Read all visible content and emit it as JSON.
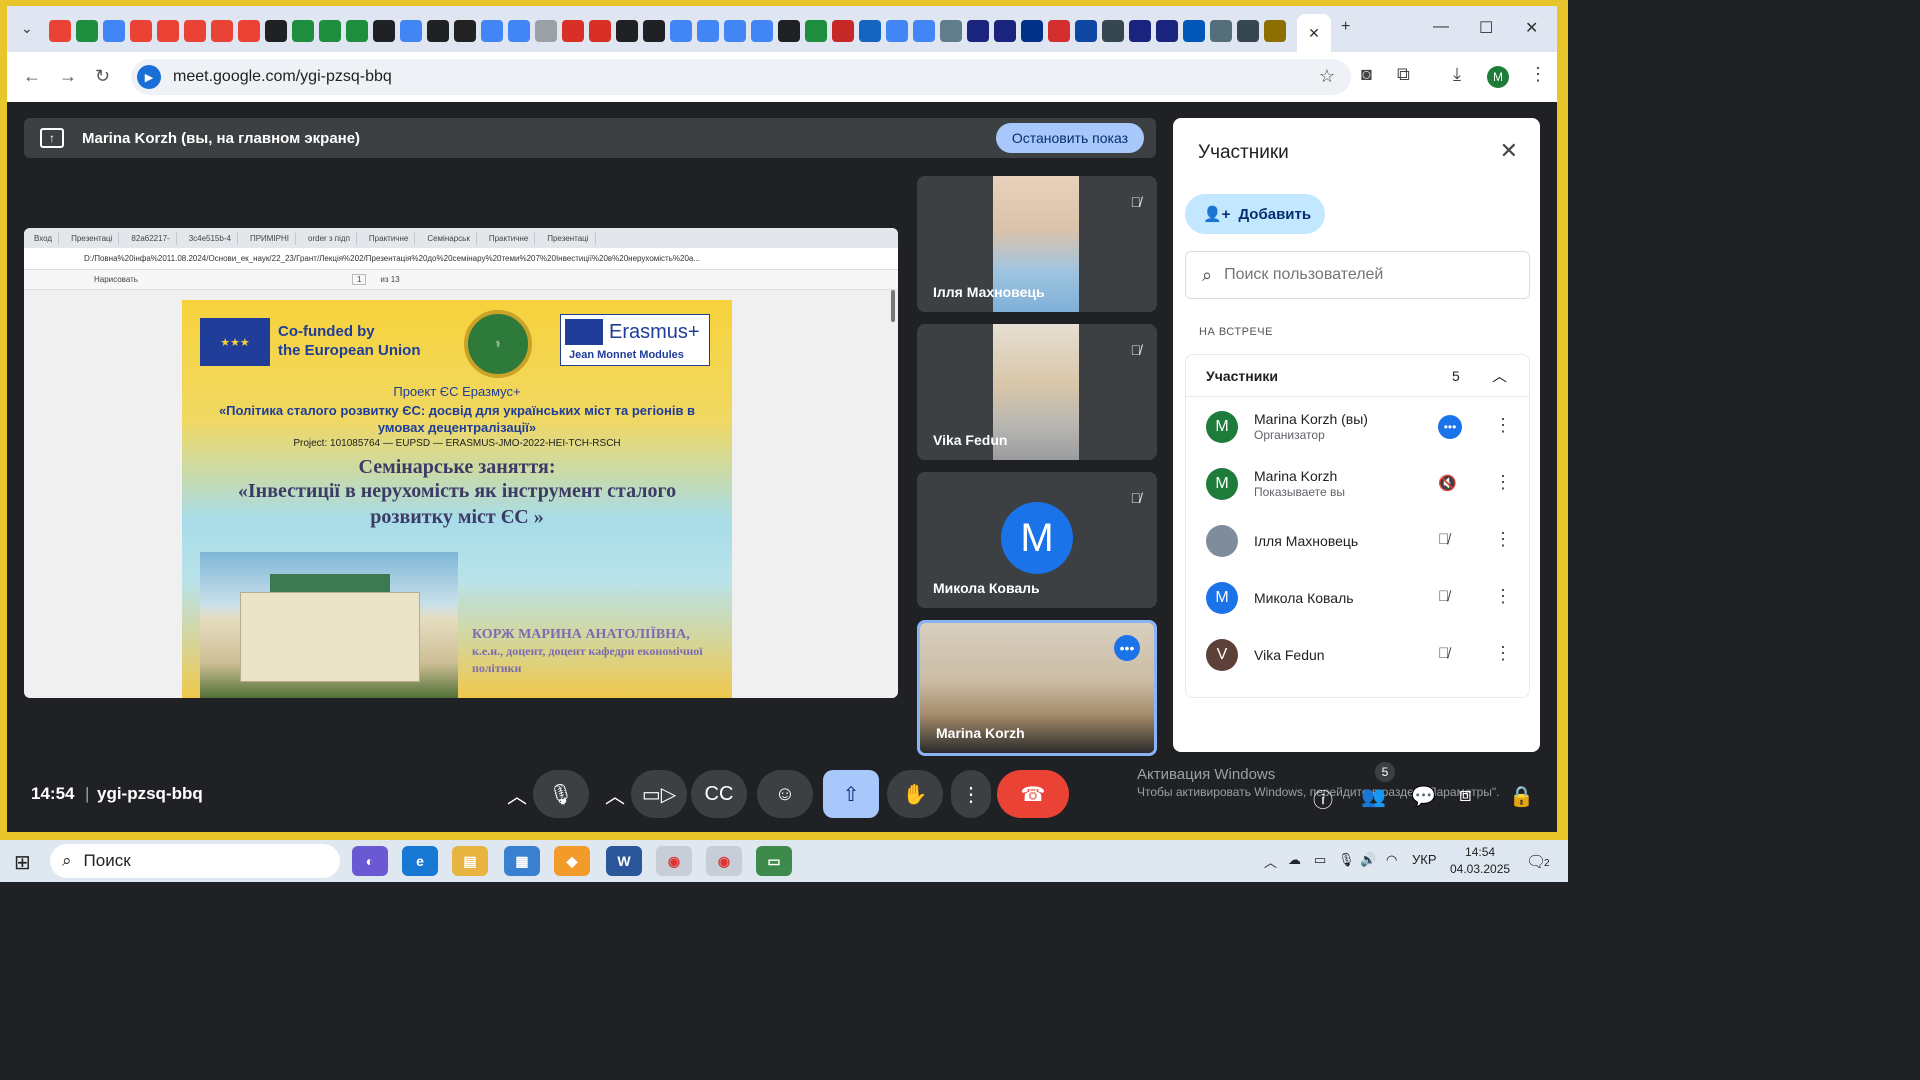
{
  "browser": {
    "url": "meet.google.com/ygi-pzsq-bbq",
    "tab_favicons": [
      "gmail",
      "drive",
      "docs",
      "gmail",
      "gmail",
      "gmail",
      "gmail",
      "gmail",
      "book",
      "drive",
      "drive",
      "drive",
      "book",
      "docs",
      "book",
      "openai",
      "docs",
      "google",
      "help",
      "heart",
      "heart",
      "book",
      "book",
      "google",
      "google",
      "docs",
      "docs",
      "book",
      "drive",
      "flag",
      "trident",
      "google",
      "google",
      "info",
      "circle",
      "circle",
      "paypal",
      "stop",
      "shield",
      "person",
      "circle",
      "circle",
      "ukraine",
      "globe",
      "person",
      "linkedin"
    ],
    "active_tab_icon": "close-icon",
    "new_tab_label": "+"
  },
  "presentation_bar": {
    "text": "Marina Korzh (вы, на главном экране)",
    "stop_label": "Остановить показ"
  },
  "shared_screen": {
    "tabs": [
      "Вход",
      "Презентаці",
      "82a62217-",
      "3c4e515b-4",
      "ПРИМІРНІ",
      "order з підп",
      "Практичне",
      "Семінарськ",
      "Практичне",
      "Презентаці"
    ],
    "address": "D:/Повна%20інфа%2011.08.2024/Основи_ек_наук/22_23/Грант/Лекція%202/Презентація%20до%20семінару%20теми%207%20Інвестиції%20в%20нерухомість%20а...",
    "toolbar": [
      "Нарисовать",
      "1",
      "из 13"
    ],
    "slide": {
      "eu_line1": "Co-funded by",
      "eu_line2": "the European Union",
      "erasmus_label": "Erasmus+",
      "erasmus_sub": "Jean Monnet Modules",
      "project_line": "Проект ЄС Еразмус+",
      "policy_line": "«Політика сталого розвитку ЄС: досвід для українських міст та регіонів в умовах децентралізації»",
      "project_code": "Project: 101085764 — EUPSD — ERASMUS-JMO-2022-HEI-TCH-RSCH",
      "seminar_title": "Семінарське заняття:",
      "seminar_topic": "«Інвестиції в нерухомість як інструмент сталого розвитку міст ЄС »",
      "author_name": "КОРЖ МАРИНА АНАТОЛІЇВНА,",
      "author_title": "к.е.н., доцент, доцент кафедри економічної політики"
    }
  },
  "tiles": [
    {
      "name": "Ілля Махновець",
      "muted": true
    },
    {
      "name": "Vika Fedun",
      "muted": true
    },
    {
      "name": "Микола Коваль",
      "muted": true,
      "avatar_letter": "M"
    },
    {
      "name": "Marina Korzh",
      "muted": false
    }
  ],
  "participants_panel": {
    "title": "Участники",
    "add_label": "Добавить",
    "search_placeholder": "Поиск пользователей",
    "section_label": "НА ВСТРЕЧЕ",
    "group_label": "Участники",
    "count": "5",
    "rows": [
      {
        "avatar": "M",
        "name": "Marina Korzh (вы)",
        "sub": "Организатор",
        "status": "more-icon",
        "color": "#1e7c3a"
      },
      {
        "avatar": "M",
        "name": "Marina Korzh",
        "sub": "Показываете вы",
        "status": "volume-off-icon",
        "color": "#1e7c3a"
      },
      {
        "avatar": "",
        "name": "Ілля Махновець",
        "sub": "",
        "status": "mic-off-icon",
        "color": "#7f8c9c"
      },
      {
        "avatar": "M",
        "name": "Микола Коваль",
        "sub": "",
        "status": "mic-off-icon",
        "color": "#1a73e8"
      },
      {
        "avatar": "V",
        "name": "Vika Fedun",
        "sub": "",
        "status": "mic-off-icon",
        "color": "#5d4037"
      }
    ]
  },
  "bottom_bar": {
    "time": "14:54",
    "meeting_code": "ygi-pzsq-bbq",
    "people_count": "5",
    "watermark_title": "Активация Windows",
    "watermark_text": "Чтобы активировать Windows, перейдите в раздел \"Параметры\"."
  },
  "taskbar": {
    "search_label": "Поиск",
    "lang": "УКР",
    "time": "14:54",
    "date": "04.03.2025",
    "notifications": "2"
  },
  "colors": {
    "accent": "#1a73e8",
    "end_call": "#ea4335",
    "present_button": "#a8c7fa",
    "meet_bg": "#202124"
  }
}
